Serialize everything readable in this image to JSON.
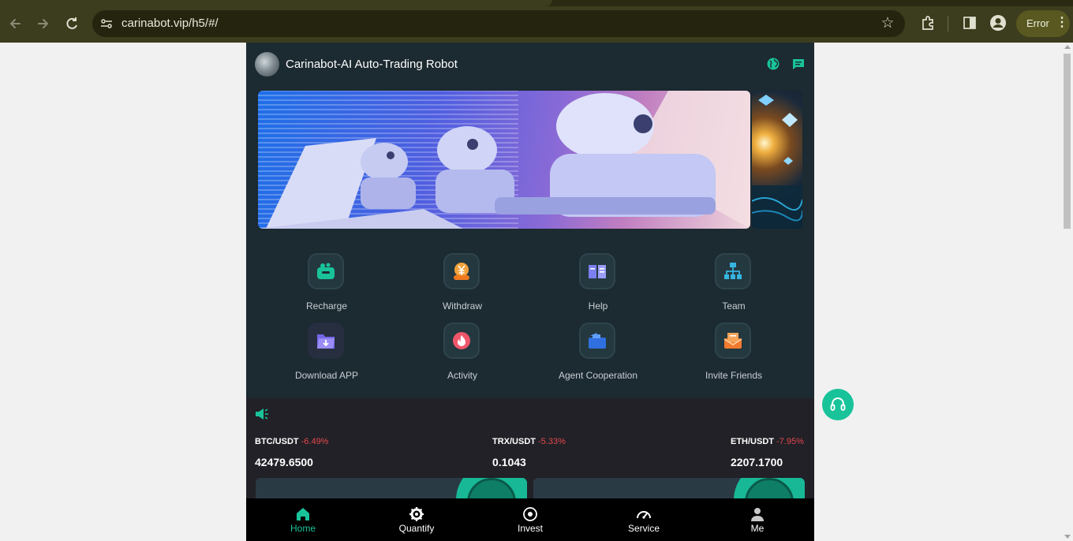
{
  "browser": {
    "url": "carinabot.vip/h5/#/",
    "profile_chip": "Error",
    "menu_glyph": "⋮"
  },
  "app": {
    "title": "Carinabot-AI Auto-Trading Robot",
    "accent_color": "#19c39a",
    "quick_menu": [
      {
        "label": "Recharge",
        "icon": "wallet-icon"
      },
      {
        "label": "Withdraw",
        "icon": "yuan-coin-icon"
      },
      {
        "label": "Help",
        "icon": "book-icon"
      },
      {
        "label": "Team",
        "icon": "team-hierarchy-icon"
      },
      {
        "label": "Download APP",
        "icon": "download-folder-icon"
      },
      {
        "label": "Activity",
        "icon": "fire-icon"
      },
      {
        "label": "Agent Cooperation",
        "icon": "briefcase-icon"
      },
      {
        "label": "Invite Friends",
        "icon": "envelope-icon"
      }
    ],
    "ticker": [
      {
        "pair": "BTC/USDT",
        "change": "-6.49%",
        "price": "42479.6500"
      },
      {
        "pair": "TRX/USDT",
        "change": "-5.33%",
        "price": "0.1043"
      },
      {
        "pair": "ETH/USDT",
        "change": "-7.95%",
        "price": "2207.1700"
      }
    ],
    "cards": [
      {
        "title": ""
      },
      {
        "title": ""
      }
    ],
    "tabbar": [
      {
        "label": "Home",
        "icon": "home-icon",
        "active": true
      },
      {
        "label": "Quantify",
        "icon": "gear-icon",
        "active": false
      },
      {
        "label": "Invest",
        "icon": "target-icon",
        "active": false
      },
      {
        "label": "Service",
        "icon": "gauge-icon",
        "active": false
      },
      {
        "label": "Me",
        "icon": "user-icon",
        "active": false
      }
    ]
  }
}
